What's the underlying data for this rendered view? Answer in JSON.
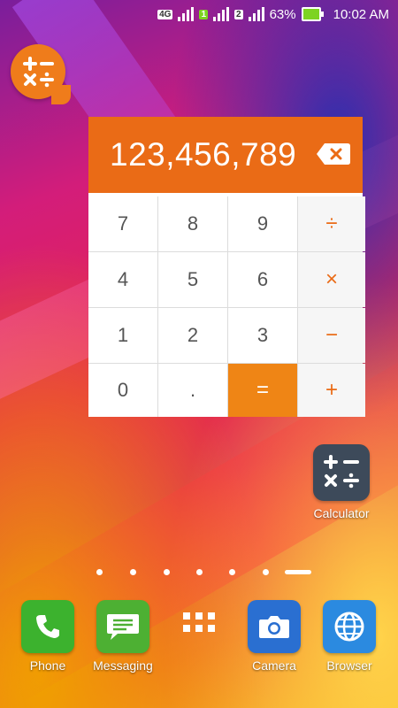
{
  "status_bar": {
    "network_type": "4G",
    "sim1": "1",
    "sim2": "2",
    "battery_percent": "63%",
    "time": "10:02 AM"
  },
  "calculator_widget": {
    "display_value": "123,456,789",
    "keys": [
      [
        "7",
        "8",
        "9",
        "÷"
      ],
      [
        "4",
        "5",
        "6",
        "×"
      ],
      [
        "1",
        "2",
        "3",
        "−"
      ],
      [
        "0",
        ".",
        "=",
        "+"
      ]
    ]
  },
  "home_icons": {
    "calculator_label": "Calculator"
  },
  "page_indicator": {
    "count": 7,
    "active_index": 6
  },
  "dock": [
    {
      "label": "Phone",
      "color": "#3cb22e",
      "icon": "phone-icon"
    },
    {
      "label": "Messaging",
      "color": "#4db033",
      "icon": "message-icon"
    },
    {
      "label": "",
      "color": "transparent",
      "icon": "app-drawer-icon"
    },
    {
      "label": "Camera",
      "color": "#2a6fd1",
      "icon": "camera-icon"
    },
    {
      "label": "Browser",
      "color": "#2b8ae0",
      "icon": "browser-icon"
    }
  ],
  "colors": {
    "accent_orange": "#ea6b16",
    "equals_orange": "#ef8515",
    "calc_icon_bg": "#3d4a5a"
  }
}
